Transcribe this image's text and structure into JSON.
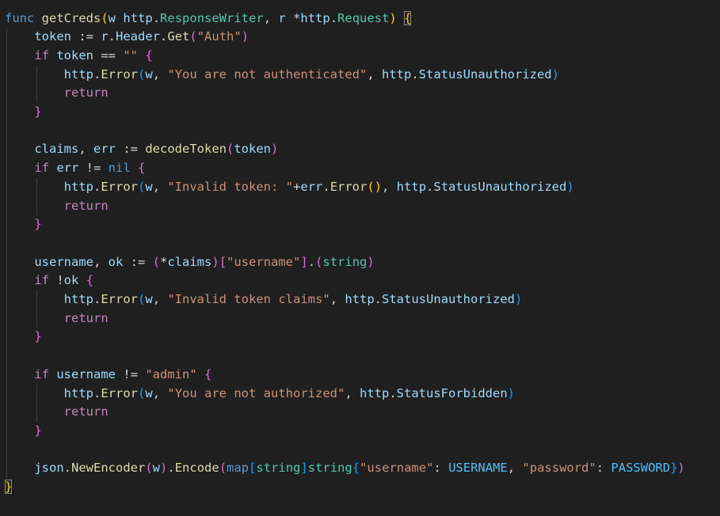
{
  "editor": {
    "language": "go",
    "colors": {
      "background": "#1f1f1f",
      "default_text": "#d4d4d4",
      "keyword": "#569cd6",
      "control_keyword": "#c586c0",
      "function": "#dcdcaa",
      "variable": "#9cdcfe",
      "type": "#4ec9b0",
      "string": "#ce9178",
      "constant": "#4fc1ff",
      "bracket_level_1": "#ffd700",
      "bracket_level_2": "#da70d6",
      "bracket_level_3": "#179fff"
    },
    "lines": [
      [
        [
          "kw",
          "func"
        ],
        [
          "op",
          " "
        ],
        [
          "fn",
          "getCreds"
        ],
        [
          "b1",
          "("
        ],
        [
          "var",
          "w"
        ],
        [
          "op",
          " "
        ],
        [
          "var",
          "http"
        ],
        [
          "op",
          "."
        ],
        [
          "type",
          "ResponseWriter"
        ],
        [
          "op",
          ", "
        ],
        [
          "var",
          "r"
        ],
        [
          "op",
          " *"
        ],
        [
          "var",
          "http"
        ],
        [
          "op",
          "."
        ],
        [
          "type",
          "Request"
        ],
        [
          "b1",
          ")"
        ],
        [
          "op",
          " "
        ],
        [
          "b1box",
          "{"
        ]
      ],
      [
        [
          "op",
          "    "
        ],
        [
          "var",
          "token"
        ],
        [
          "op",
          " := "
        ],
        [
          "var",
          "r"
        ],
        [
          "op",
          "."
        ],
        [
          "var",
          "Header"
        ],
        [
          "op",
          "."
        ],
        [
          "fn",
          "Get"
        ],
        [
          "b2",
          "("
        ],
        [
          "str",
          "\"Auth\""
        ],
        [
          "b2",
          ")"
        ]
      ],
      [
        [
          "op",
          "    "
        ],
        [
          "ctrl",
          "if"
        ],
        [
          "op",
          " "
        ],
        [
          "var",
          "token"
        ],
        [
          "op",
          " == "
        ],
        [
          "str",
          "\"\""
        ],
        [
          "op",
          " "
        ],
        [
          "b2",
          "{"
        ]
      ],
      [
        [
          "op",
          "        "
        ],
        [
          "var",
          "http"
        ],
        [
          "op",
          "."
        ],
        [
          "fn",
          "Error"
        ],
        [
          "b3",
          "("
        ],
        [
          "var",
          "w"
        ],
        [
          "op",
          ", "
        ],
        [
          "str",
          "\"You are not authenticated\""
        ],
        [
          "op",
          ", "
        ],
        [
          "var",
          "http"
        ],
        [
          "op",
          "."
        ],
        [
          "var",
          "StatusUnauthorized"
        ],
        [
          "b3",
          ")"
        ]
      ],
      [
        [
          "op",
          "        "
        ],
        [
          "ctrl",
          "return"
        ]
      ],
      [
        [
          "op",
          "    "
        ],
        [
          "b2",
          "}"
        ]
      ],
      [],
      [
        [
          "op",
          "    "
        ],
        [
          "var",
          "claims"
        ],
        [
          "op",
          ", "
        ],
        [
          "var",
          "err"
        ],
        [
          "op",
          " := "
        ],
        [
          "fn",
          "decodeToken"
        ],
        [
          "b2",
          "("
        ],
        [
          "var",
          "token"
        ],
        [
          "b2",
          ")"
        ]
      ],
      [
        [
          "op",
          "    "
        ],
        [
          "ctrl",
          "if"
        ],
        [
          "op",
          " "
        ],
        [
          "var",
          "err"
        ],
        [
          "op",
          " != "
        ],
        [
          "kw",
          "nil"
        ],
        [
          "op",
          " "
        ],
        [
          "b2",
          "{"
        ]
      ],
      [
        [
          "op",
          "        "
        ],
        [
          "var",
          "http"
        ],
        [
          "op",
          "."
        ],
        [
          "fn",
          "Error"
        ],
        [
          "b3",
          "("
        ],
        [
          "var",
          "w"
        ],
        [
          "op",
          ", "
        ],
        [
          "str",
          "\"Invalid token: \""
        ],
        [
          "op",
          "+"
        ],
        [
          "var",
          "err"
        ],
        [
          "op",
          "."
        ],
        [
          "fn",
          "Error"
        ],
        [
          "b1",
          "()"
        ],
        [
          "op",
          ", "
        ],
        [
          "var",
          "http"
        ],
        [
          "op",
          "."
        ],
        [
          "var",
          "StatusUnauthorized"
        ],
        [
          "b3",
          ")"
        ]
      ],
      [
        [
          "op",
          "        "
        ],
        [
          "ctrl",
          "return"
        ]
      ],
      [
        [
          "op",
          "    "
        ],
        [
          "b2",
          "}"
        ]
      ],
      [],
      [
        [
          "op",
          "    "
        ],
        [
          "var",
          "username"
        ],
        [
          "op",
          ", "
        ],
        [
          "var",
          "ok"
        ],
        [
          "op",
          " := "
        ],
        [
          "b2",
          "("
        ],
        [
          "op",
          "*"
        ],
        [
          "var",
          "claims"
        ],
        [
          "b2",
          ")"
        ],
        [
          "b2",
          "["
        ],
        [
          "str",
          "\"username\""
        ],
        [
          "b2",
          "]"
        ],
        [
          "op",
          "."
        ],
        [
          "b2",
          "("
        ],
        [
          "type",
          "string"
        ],
        [
          "b2",
          ")"
        ]
      ],
      [
        [
          "op",
          "    "
        ],
        [
          "ctrl",
          "if"
        ],
        [
          "op",
          " !"
        ],
        [
          "var",
          "ok"
        ],
        [
          "op",
          " "
        ],
        [
          "b2",
          "{"
        ]
      ],
      [
        [
          "op",
          "        "
        ],
        [
          "var",
          "http"
        ],
        [
          "op",
          "."
        ],
        [
          "fn",
          "Error"
        ],
        [
          "b3",
          "("
        ],
        [
          "var",
          "w"
        ],
        [
          "op",
          ", "
        ],
        [
          "str",
          "\"Invalid token claims\""
        ],
        [
          "op",
          ", "
        ],
        [
          "var",
          "http"
        ],
        [
          "op",
          "."
        ],
        [
          "var",
          "StatusUnauthorized"
        ],
        [
          "b3",
          ")"
        ]
      ],
      [
        [
          "op",
          "        "
        ],
        [
          "ctrl",
          "return"
        ]
      ],
      [
        [
          "op",
          "    "
        ],
        [
          "b2",
          "}"
        ]
      ],
      [],
      [
        [
          "op",
          "    "
        ],
        [
          "ctrl",
          "if"
        ],
        [
          "op",
          " "
        ],
        [
          "var",
          "username"
        ],
        [
          "op",
          " != "
        ],
        [
          "str",
          "\"admin\""
        ],
        [
          "op",
          " "
        ],
        [
          "b2",
          "{"
        ]
      ],
      [
        [
          "op",
          "        "
        ],
        [
          "var",
          "http"
        ],
        [
          "op",
          "."
        ],
        [
          "fn",
          "Error"
        ],
        [
          "b3",
          "("
        ],
        [
          "var",
          "w"
        ],
        [
          "op",
          ", "
        ],
        [
          "str",
          "\"You are not authorized\""
        ],
        [
          "op",
          ", "
        ],
        [
          "var",
          "http"
        ],
        [
          "op",
          "."
        ],
        [
          "var",
          "StatusForbidden"
        ],
        [
          "b3",
          ")"
        ]
      ],
      [
        [
          "op",
          "        "
        ],
        [
          "ctrl",
          "return"
        ]
      ],
      [
        [
          "op",
          "    "
        ],
        [
          "b2",
          "}"
        ]
      ],
      [],
      [
        [
          "op",
          "    "
        ],
        [
          "var",
          "json"
        ],
        [
          "op",
          "."
        ],
        [
          "fn",
          "NewEncoder"
        ],
        [
          "b2",
          "("
        ],
        [
          "var",
          "w"
        ],
        [
          "b2",
          ")"
        ],
        [
          "op",
          "."
        ],
        [
          "fn",
          "Encode"
        ],
        [
          "b2",
          "("
        ],
        [
          "kw",
          "map"
        ],
        [
          "b3",
          "["
        ],
        [
          "type",
          "string"
        ],
        [
          "b3",
          "]"
        ],
        [
          "type",
          "string"
        ],
        [
          "b3",
          "{"
        ],
        [
          "str",
          "\"username\""
        ],
        [
          "op",
          ": "
        ],
        [
          "const",
          "USERNAME"
        ],
        [
          "op",
          ", "
        ],
        [
          "str",
          "\"password\""
        ],
        [
          "op",
          ": "
        ],
        [
          "const",
          "PASSWORD"
        ],
        [
          "b3",
          "}"
        ],
        [
          "b2",
          ")"
        ]
      ],
      [
        [
          "b1box",
          "}"
        ]
      ]
    ]
  }
}
